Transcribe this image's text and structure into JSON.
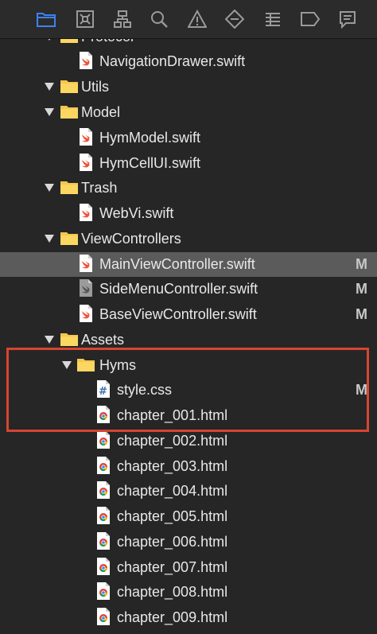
{
  "toolbar": {
    "icons": [
      "folder-icon",
      "source-control-icon",
      "hierarchy-icon",
      "search-icon",
      "warning-icon",
      "test-icon",
      "debug-icon",
      "breakpoint-icon",
      "report-icon"
    ]
  },
  "tree": {
    "rows": [
      {
        "label": "Protocol",
        "type": "folder",
        "expanded": true
      },
      {
        "label": "NavigationDrawer.swift",
        "type": "swift"
      },
      {
        "label": "Utils",
        "type": "folder",
        "expanded": true
      },
      {
        "label": "Model",
        "type": "folder",
        "expanded": true
      },
      {
        "label": "HymModel.swift",
        "type": "swift"
      },
      {
        "label": "HymCellUI.swift",
        "type": "swift"
      },
      {
        "label": "Trash",
        "type": "folder",
        "expanded": true
      },
      {
        "label": "WebVi.swift",
        "type": "swift"
      },
      {
        "label": "ViewControllers",
        "type": "folder",
        "expanded": true
      },
      {
        "label": "MainViewController.swift",
        "type": "swift",
        "status": "M"
      },
      {
        "label": "SideMenuController.swift",
        "type": "swift-gray",
        "status": "M"
      },
      {
        "label": "BaseViewController.swift",
        "type": "swift",
        "status": "M"
      },
      {
        "label": "Assets",
        "type": "folder",
        "expanded": true
      },
      {
        "label": "Hyms",
        "type": "folder",
        "expanded": true
      },
      {
        "label": "style.css",
        "type": "css",
        "status": "M"
      },
      {
        "label": "chapter_001.html",
        "type": "html"
      },
      {
        "label": "chapter_002.html",
        "type": "html"
      },
      {
        "label": "chapter_003.html",
        "type": "html"
      },
      {
        "label": "chapter_004.html",
        "type": "html"
      },
      {
        "label": "chapter_005.html",
        "type": "html"
      },
      {
        "label": "chapter_006.html",
        "type": "html"
      },
      {
        "label": "chapter_007.html",
        "type": "html"
      },
      {
        "label": "chapter_008.html",
        "type": "html"
      },
      {
        "label": "chapter_009.html",
        "type": "html"
      }
    ]
  },
  "colors": {
    "background": "#262626",
    "selected_row": "#5b5b5b",
    "folder": "#f5c64f",
    "swift": "#f05138",
    "toolbar_active": "#3b82f6",
    "highlight": "#d64531"
  }
}
